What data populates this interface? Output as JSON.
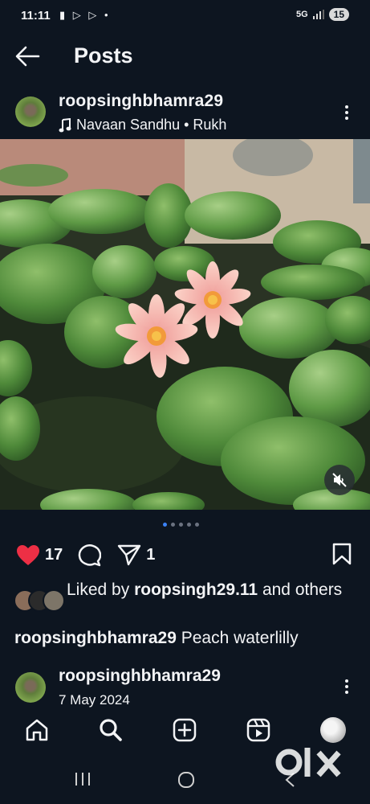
{
  "status_bar": {
    "time": "11:11",
    "left_icons": "▮ ▷ ▷ •",
    "network": "5G",
    "battery": "15"
  },
  "header": {
    "title": "Posts"
  },
  "post": {
    "username": "roopsinghbhamra29",
    "music": "Navaan Sandhu • Rukh",
    "likes_count": "17",
    "shares_count": "1",
    "liked_by_prefix": "Liked by ",
    "liked_by_user": "roopsingh29.11",
    "liked_by_suffix": " and others",
    "caption_user": "roopsinghbhamra29",
    "caption_text": " Peach waterlilly",
    "carousel_total": 5,
    "carousel_current": 1
  },
  "next_post": {
    "username": "roopsinghbhamra29",
    "date": "7 May 2024"
  },
  "watermark": "olx",
  "colors": {
    "background": "#0d1520",
    "like_red": "#ed2f45",
    "pager_active": "#3b82f6"
  },
  "icons": [
    "back-arrow-icon",
    "music-note-icon",
    "more-icon",
    "heart-icon",
    "comment-icon",
    "share-icon",
    "bookmark-icon",
    "mute-icon",
    "home-icon",
    "search-icon",
    "create-icon",
    "reels-icon",
    "recents-icon",
    "home-circle-icon",
    "back-chevron-icon"
  ]
}
